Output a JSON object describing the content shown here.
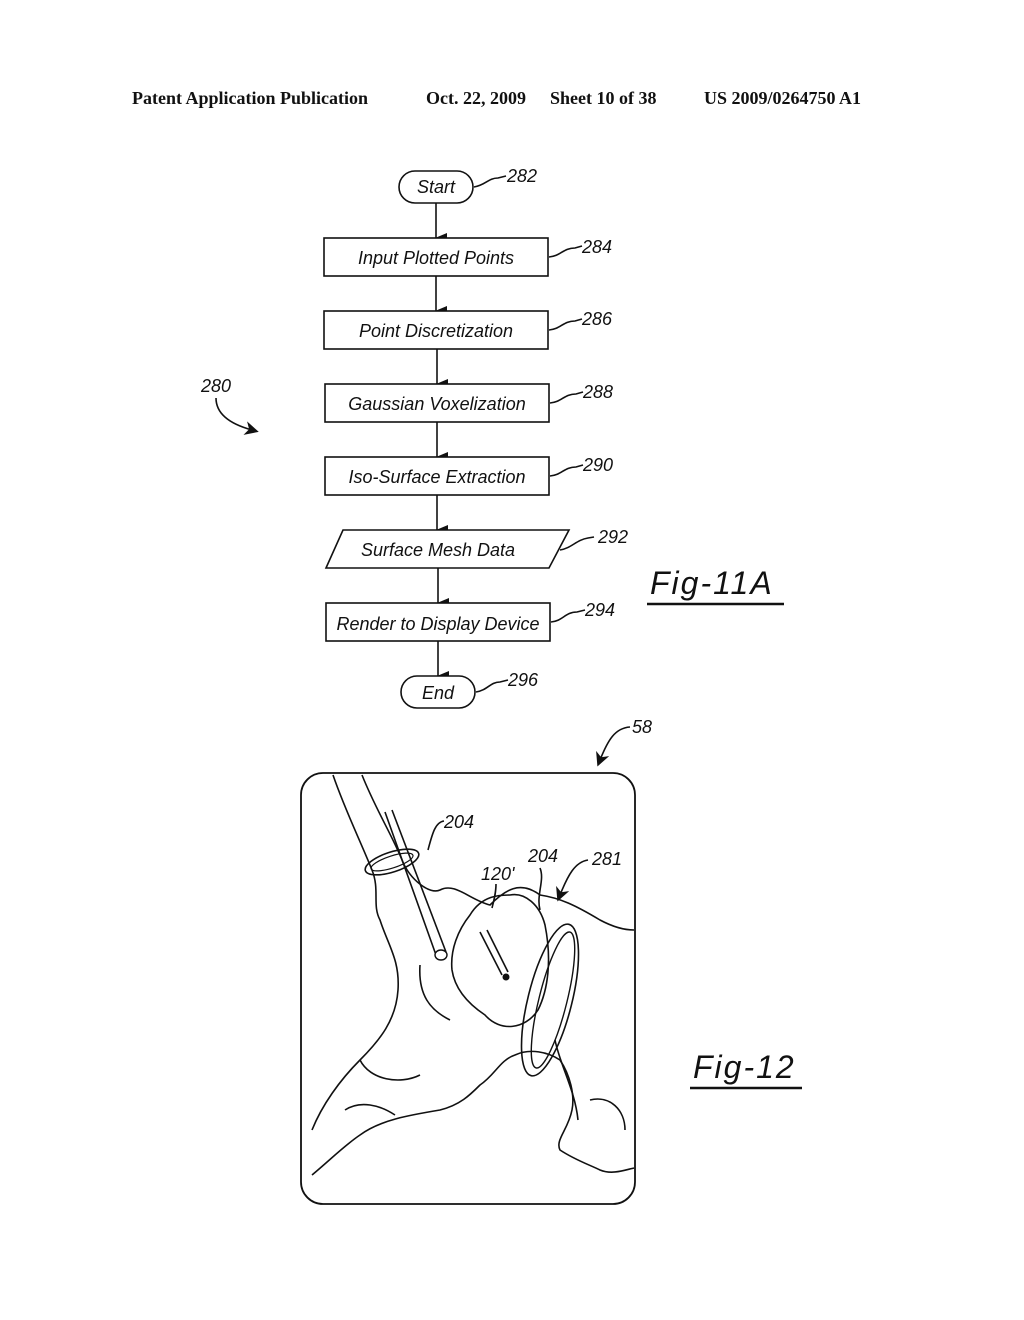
{
  "header": {
    "publication": "Patent Application Publication",
    "date": "Oct. 22, 2009",
    "sheet": "Sheet 10 of 38",
    "number": "US 2009/0264750 A1"
  },
  "fig11a": {
    "label": "Fig-11A",
    "ref": "280",
    "nodes": [
      {
        "id": "start",
        "shape": "terminal",
        "text": "Start",
        "ref": "282"
      },
      {
        "id": "input",
        "shape": "process",
        "text": "Input Plotted Points",
        "ref": "284"
      },
      {
        "id": "discretize",
        "shape": "process",
        "text": "Point Discretization",
        "ref": "286"
      },
      {
        "id": "voxel",
        "shape": "process",
        "text": "Gaussian Voxelization",
        "ref": "288"
      },
      {
        "id": "isosurface",
        "shape": "process",
        "text": "Iso-Surface Extraction",
        "ref": "290"
      },
      {
        "id": "mesh",
        "shape": "data",
        "text": "Surface Mesh Data",
        "ref": "292"
      },
      {
        "id": "render",
        "shape": "process",
        "text": "Render to Display Device",
        "ref": "294"
      },
      {
        "id": "end",
        "shape": "terminal",
        "text": "End",
        "ref": "296"
      }
    ]
  },
  "fig12": {
    "label": "Fig-12",
    "refs": {
      "display": "58",
      "ring_upper": "204",
      "ring_lower": "204",
      "catheter": "120'",
      "surface": "281"
    }
  }
}
